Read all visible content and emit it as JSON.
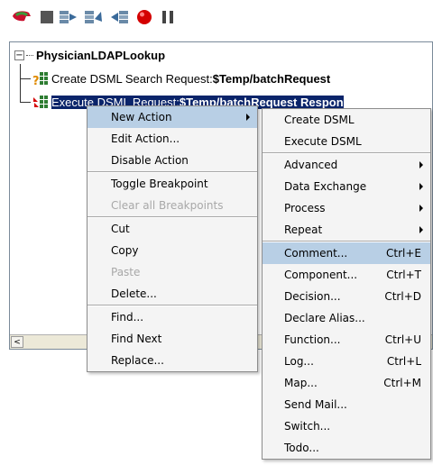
{
  "toolbar": {
    "buttons": [
      {
        "name": "run-icon",
        "color": "#c8102e"
      },
      {
        "name": "stop-icon",
        "color": "#555555"
      },
      {
        "name": "step-into-icon",
        "color": "#5a7a9a"
      },
      {
        "name": "step-over-icon",
        "color": "#5a7a9a"
      },
      {
        "name": "step-out-icon",
        "color": "#5a7a9a"
      },
      {
        "name": "breakpoint-icon",
        "color": "#d40000"
      },
      {
        "name": "pause-icon",
        "color": "#444444"
      }
    ]
  },
  "tree": {
    "root": {
      "expander": "−",
      "label": "PhysicianLDAPLookup"
    },
    "nodes": [
      {
        "prefix": "Create DSML Search Request: ",
        "bold": "$Temp/batchRequest",
        "selected": false
      },
      {
        "prefix": "Execute DSML Request:",
        "bold": "$Temp/batchRequest Respon",
        "selected": true
      }
    ]
  },
  "scrollbar": {
    "left_arrow": "<"
  },
  "context_menu": {
    "items": [
      {
        "label": "New Action",
        "submenu": true,
        "highlighted": true
      },
      {
        "label": "Edit Action...",
        "disabled": false
      },
      {
        "label": "Disable Action",
        "disabled": false
      },
      {
        "label": "Toggle Breakpoint",
        "disabled": false
      },
      {
        "label": "Clear all Breakpoints",
        "disabled": true
      },
      {
        "label": "Cut",
        "disabled": false
      },
      {
        "label": "Copy",
        "disabled": false
      },
      {
        "label": "Paste",
        "disabled": true
      },
      {
        "label": "Delete...",
        "disabled": false
      },
      {
        "label": "Find...",
        "disabled": false
      },
      {
        "label": "Find Next",
        "disabled": false
      },
      {
        "label": "Replace...",
        "disabled": false
      }
    ]
  },
  "submenu": {
    "items": [
      {
        "label": "Create DSML"
      },
      {
        "label": "Execute DSML"
      },
      {
        "label": "Advanced",
        "submenu": true
      },
      {
        "label": "Data Exchange",
        "submenu": true
      },
      {
        "label": "Process",
        "submenu": true
      },
      {
        "label": "Repeat",
        "submenu": true
      },
      {
        "label": "Comment...",
        "accel": "Ctrl+E",
        "highlighted": true
      },
      {
        "label": "Component...",
        "accel": "Ctrl+T"
      },
      {
        "label": "Decision...",
        "accel": "Ctrl+D"
      },
      {
        "label": "Declare Alias..."
      },
      {
        "label": "Function...",
        "accel": "Ctrl+U"
      },
      {
        "label": "Log...",
        "accel": "Ctrl+L"
      },
      {
        "label": "Map...",
        "accel": "Ctrl+M"
      },
      {
        "label": "Send Mail..."
      },
      {
        "label": "Switch..."
      },
      {
        "label": "Todo..."
      }
    ]
  },
  "colors": {
    "selection": "#0a246a",
    "menu_highlight": "#b8cfe5"
  }
}
